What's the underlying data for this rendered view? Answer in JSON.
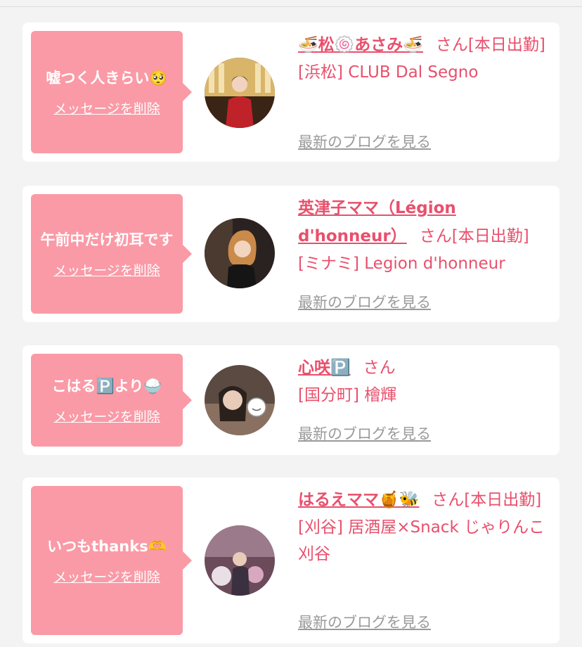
{
  "delete_label": "メッセージを削除",
  "san_label": "さん",
  "blog_label": "最新のブログを見る",
  "colors": {
    "bubble": "#fa9aa6",
    "accent": "#e8506c",
    "muted": "#9a9a9a",
    "page_bg": "#f3f3f3"
  },
  "cards": [
    {
      "message": "嘘つく人きらい🥺",
      "name": "🍜松🍥あさみ🍜",
      "status": "[本日出勤]",
      "shop": "[浜松] CLUB Dal Segno"
    },
    {
      "message": "午前中だけ初耳です",
      "name": "英津子ママ（Légion d'honneur）",
      "status": "[本日出勤]",
      "shop": "[ミナミ] Legion d'honneur"
    },
    {
      "message": "こはる🅿️より🍚",
      "name": "心咲🅿️",
      "status": "",
      "shop": "[国分町] 檜輝"
    },
    {
      "message": "いつもthanks🫶",
      "name": "はるえママ🍯🐝",
      "status": "[本日出勤]",
      "shop": "[刈谷] 居酒屋×Snack じゃりんこ刈谷"
    }
  ]
}
